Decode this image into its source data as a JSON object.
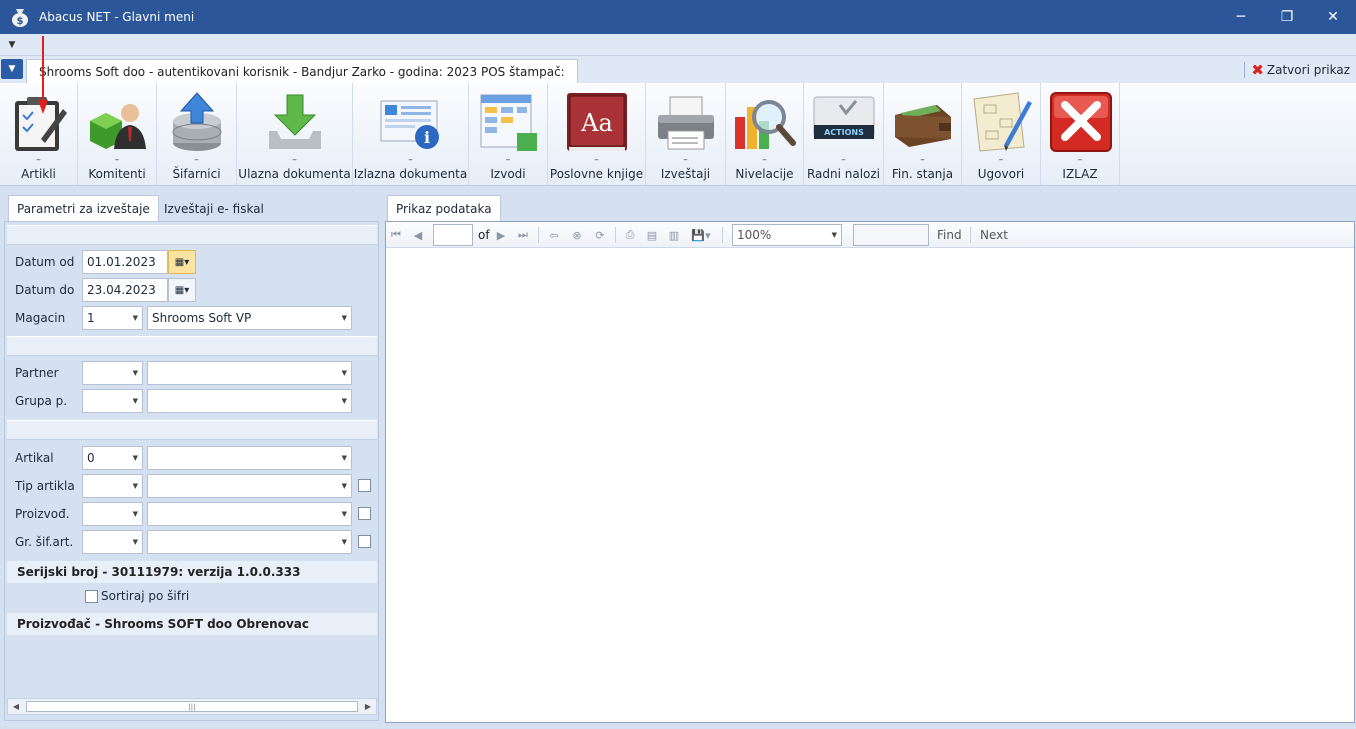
{
  "window": {
    "title": "Abacus NET - Glavni meni",
    "minimize": "─",
    "restore": "❐",
    "close": "✕"
  },
  "main_tab": {
    "label": "Shrooms Soft doo - autentikovani korisnik - Bandjur Zarko - godina: 2023 POS štampač:"
  },
  "close_view": {
    "label": "Zatvori prikaz"
  },
  "ribbon": {
    "dash": "–",
    "items": [
      {
        "label": "Artikli",
        "icon": "clipboard-pen-icon"
      },
      {
        "label": "Komitenti",
        "icon": "user-cube-icon"
      },
      {
        "label": "Šifarnici",
        "icon": "database-upload-icon"
      },
      {
        "label": "Ulazna dokumenta",
        "icon": "download-tray-icon"
      },
      {
        "label": "Izlazna dokumenta",
        "icon": "document-info-icon"
      },
      {
        "label": "Izvodi",
        "icon": "calendar-sheet-icon"
      },
      {
        "label": "Poslovne knjige",
        "icon": "dictionary-book-icon"
      },
      {
        "label": "Izveštaji",
        "icon": "printer-icon"
      },
      {
        "label": "Nivelacije",
        "icon": "chart-magnifier-icon"
      },
      {
        "label": "Radni nalozi",
        "icon": "actions-folder-icon"
      },
      {
        "label": "Fin. stanja",
        "icon": "wallet-icon"
      },
      {
        "label": "Ugovori",
        "icon": "diagram-pencil-icon"
      },
      {
        "label": "IZLAZ",
        "icon": "exit-x-icon"
      }
    ],
    "actions_text": "ACTIONS",
    "book_text": "Aa"
  },
  "left": {
    "tabs": [
      "Parametri za izveštaje",
      "Izveštaji e- fiskal"
    ],
    "datum_od": {
      "label": "Datum od",
      "value": "01.01.2023"
    },
    "datum_do": {
      "label": "Datum do",
      "value": "23.04.2023"
    },
    "magacin": {
      "label": "Magacin",
      "code": "1",
      "name": "Shrooms Soft VP"
    },
    "partner": {
      "label": "Partner"
    },
    "grupa": {
      "label": "Grupa p."
    },
    "artikal": {
      "label": "Artikal",
      "code": "0"
    },
    "tip_artikla": {
      "label": "Tip artikla"
    },
    "proizvod": {
      "label": "Proizvođ."
    },
    "gr_sif": {
      "label": "Gr. šif.art."
    },
    "serial": "Serijski broj - 30111979: verzija 1.0.0.333",
    "sort_label": "Sortiraj po šifri",
    "producer": "Proizvođač - Shrooms SOFT doo Obrenovac"
  },
  "right": {
    "tab": "Prikaz podataka",
    "of_label": "of",
    "zoom": "100%",
    "find": "Find",
    "next": "Next"
  }
}
